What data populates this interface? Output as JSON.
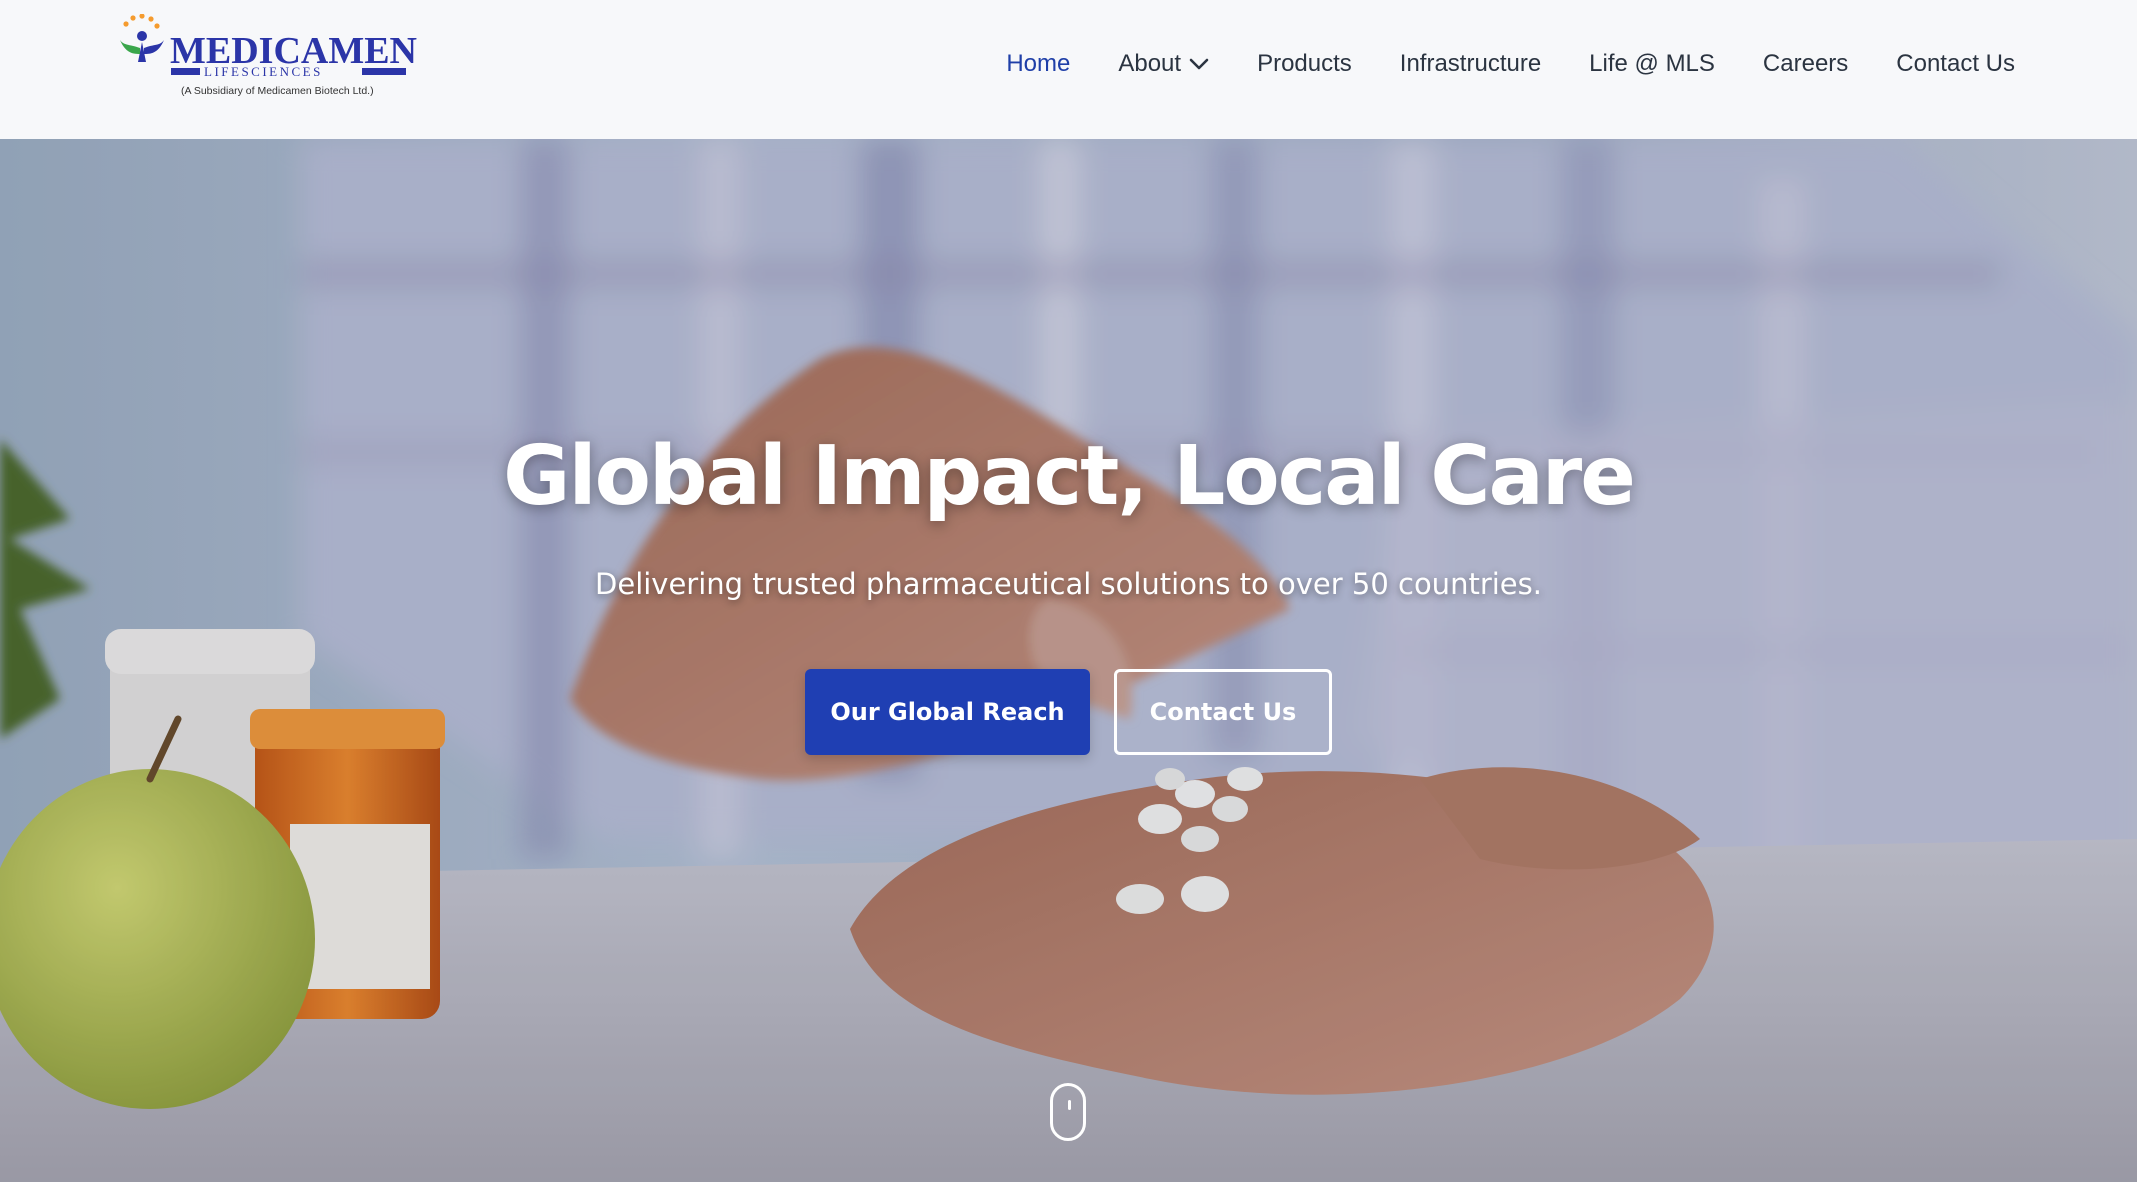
{
  "brand": {
    "name": "MEDICAMEN",
    "sub": "LIFESCIENCES",
    "tagline": "(A Subsidiary of Medicamen Biotech Ltd.)",
    "color": "#2b35a8",
    "accent_green": "#3aa64b",
    "accent_orange": "#f59b2e"
  },
  "nav": {
    "items": [
      {
        "label": "Home",
        "active": true
      },
      {
        "label": "About",
        "has_dropdown": true
      },
      {
        "label": "Products"
      },
      {
        "label": "Infrastructure"
      },
      {
        "label": "Life @ MLS"
      },
      {
        "label": "Careers"
      },
      {
        "label": "Contact Us"
      }
    ],
    "active_color": "#1f3fa8"
  },
  "hero": {
    "title": "Global Impact, Local Care",
    "subtitle": "Delivering trusted pharmaceutical solutions to over 50 countries.",
    "primary_button": "Our Global Reach",
    "secondary_button": "Contact Us",
    "primary_color": "#1f3fb3",
    "background_image": "hand-holding-pills-photo",
    "scroll_icon": "mouse-scroll-icon"
  }
}
